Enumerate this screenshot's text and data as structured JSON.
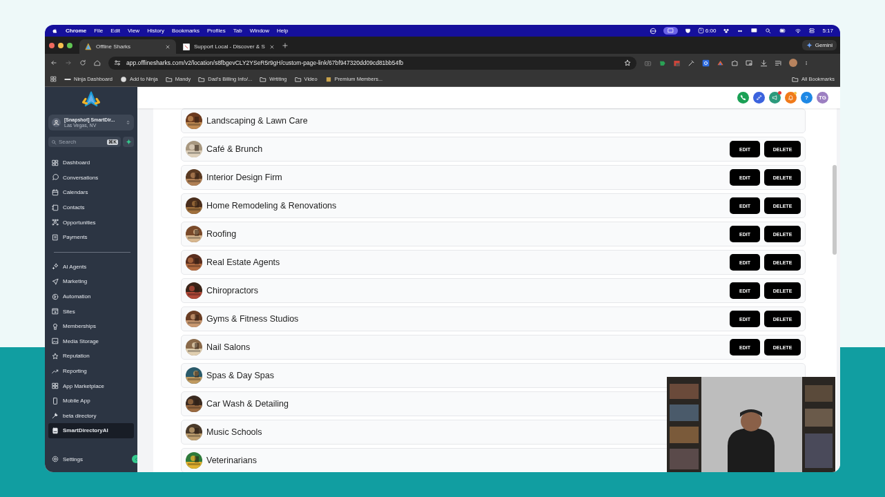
{
  "menu_bar": {
    "app": "Chrome",
    "menus": [
      "File",
      "Edit",
      "View",
      "History",
      "Bookmarks",
      "Profiles",
      "Tab",
      "Window",
      "Help"
    ],
    "timer": "6:00",
    "clock": "5:17"
  },
  "browser": {
    "tabs": [
      {
        "title": "Offline Sharks",
        "selected": true
      },
      {
        "title": "Support Local - Discover & S",
        "selected": false
      }
    ],
    "gemini": "Gemini",
    "url": "app.offlinesharks.com/v2/location/s8fbgevCLY2YSeR5r9gH/custom-page-link/67bf947320dd09cd81bb54fb",
    "bookmarks": [
      {
        "label": "Ninja Dashboard",
        "kind": "dash"
      },
      {
        "label": "Add to Ninja",
        "kind": "globe"
      },
      {
        "label": "Mandy",
        "kind": "folder"
      },
      {
        "label": "Dad's Billing Info/...",
        "kind": "folder"
      },
      {
        "label": "Wrtiting",
        "kind": "folder"
      },
      {
        "label": "Video",
        "kind": "folder"
      },
      {
        "label": "Premium Members...",
        "kind": "logo"
      }
    ],
    "all_bookmarks": "All Bookmarks"
  },
  "sidebar": {
    "account": {
      "name": "[Snapshot] SmartDir...",
      "location": "Las Vegas, NV"
    },
    "search": {
      "placeholder": "Search",
      "shortcut": "⌘K"
    },
    "nav_groups": [
      [
        {
          "label": "Dashboard",
          "selected": false
        },
        {
          "label": "Conversations",
          "selected": false
        },
        {
          "label": "Calendars",
          "selected": false
        },
        {
          "label": "Contacts",
          "selected": false
        },
        {
          "label": "Opportunities",
          "selected": false
        },
        {
          "label": "Payments",
          "selected": false
        }
      ],
      [
        {
          "label": "AI Agents",
          "selected": false
        },
        {
          "label": "Marketing",
          "selected": false
        },
        {
          "label": "Automation",
          "selected": false
        },
        {
          "label": "Sites",
          "selected": false
        },
        {
          "label": "Memberships",
          "selected": false
        },
        {
          "label": "Media Storage",
          "selected": false
        },
        {
          "label": "Reputation",
          "selected": false
        },
        {
          "label": "Reporting",
          "selected": false
        },
        {
          "label": "App Marketplace",
          "selected": false
        },
        {
          "label": "Mobile App",
          "selected": false
        },
        {
          "label": "beta directory",
          "selected": false
        },
        {
          "label": "SmartDirectoryAI",
          "selected": true
        }
      ]
    ],
    "settings": "Settings"
  },
  "header": {
    "help": "?",
    "avatar": "TG"
  },
  "categories": [
    {
      "name": "Landscaping & Lawn Care"
    },
    {
      "name": "Café & Brunch",
      "buttons": [
        "EDIT",
        "DELETE"
      ]
    },
    {
      "name": "Interior Design Firm",
      "buttons": [
        "EDIT",
        "DELETE"
      ]
    },
    {
      "name": "Home Remodeling & Renovations",
      "buttons": [
        "EDIT",
        "DELETE"
      ]
    },
    {
      "name": "Roofing",
      "buttons": [
        "EDIT",
        "DELETE"
      ]
    },
    {
      "name": "Real Estate Agents",
      "buttons": [
        "EDIT",
        "DELETE"
      ]
    },
    {
      "name": "Chiropractors",
      "buttons": [
        "EDIT",
        "DELETE"
      ]
    },
    {
      "name": "Gyms & Fitness Studios",
      "buttons": [
        "EDIT",
        "DELETE"
      ]
    },
    {
      "name": "Nail Salons",
      "buttons": [
        "EDIT",
        "DELETE"
      ]
    },
    {
      "name": "Spas & Day Spas"
    },
    {
      "name": "Car Wash & Detailing"
    },
    {
      "name": "Music Schools"
    },
    {
      "name": "Veterinarians"
    }
  ]
}
